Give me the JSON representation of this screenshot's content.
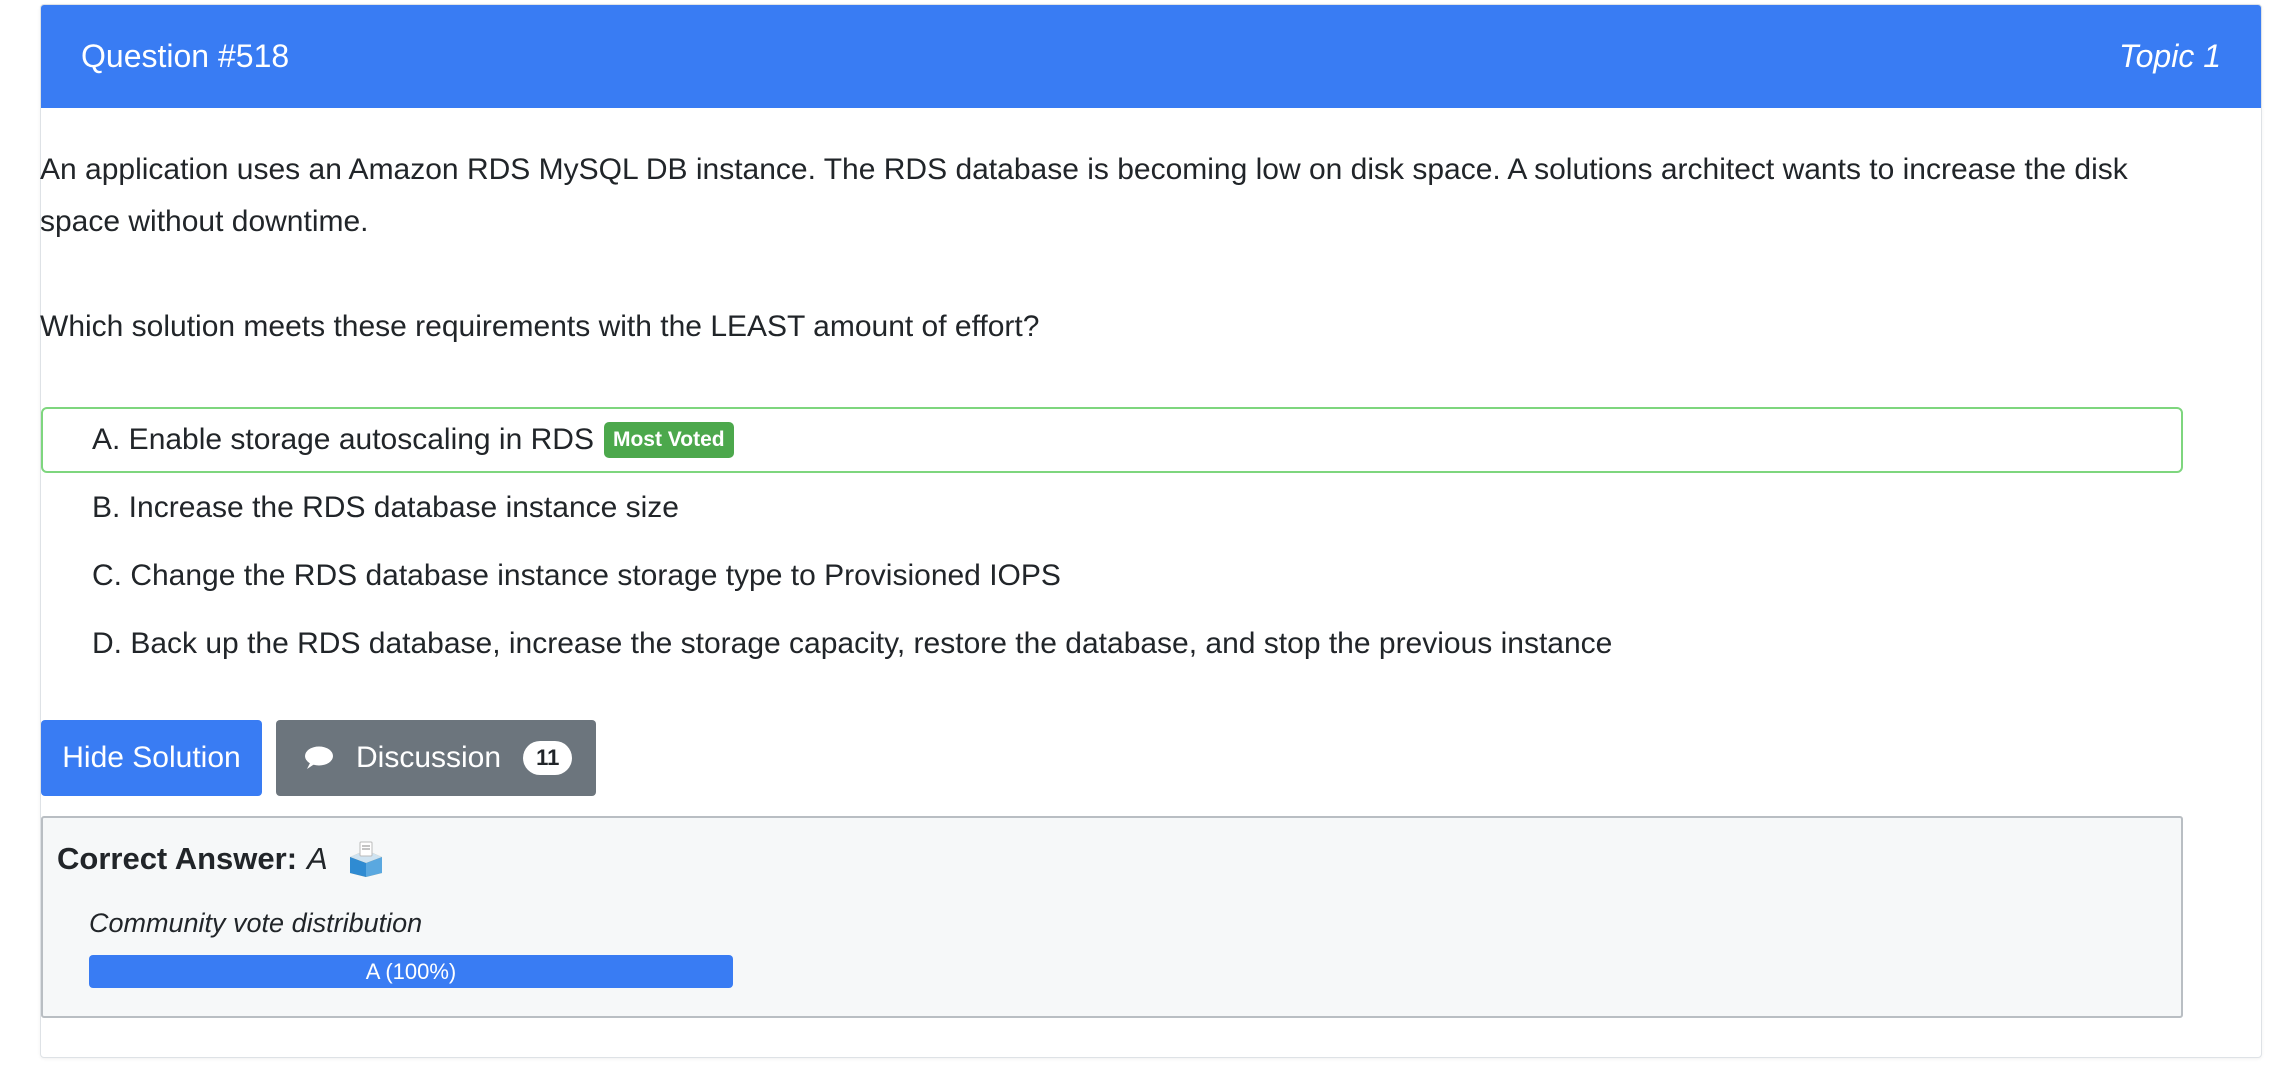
{
  "header": {
    "question_number": "Question #518",
    "topic": "Topic 1"
  },
  "question": {
    "text": "An application uses an Amazon RDS MySQL DB instance. The RDS database is becoming low on disk space. A solutions architect wants to increase the disk space without downtime.",
    "prompt": "Which solution meets these requirements with the LEAST amount of effort?"
  },
  "choices": [
    {
      "label": "A. Enable storage autoscaling in RDS",
      "badge": "Most Voted"
    },
    {
      "label": "B. Increase the RDS database instance size"
    },
    {
      "label": "C. Change the RDS database instance storage type to Provisioned IOPS"
    },
    {
      "label": "D. Back up the RDS database, increase the storage capacity, restore the database, and stop the previous instance"
    }
  ],
  "buttons": {
    "hide_solution": "Hide Solution",
    "discussion": "Discussion",
    "discussion_count": "11"
  },
  "answer": {
    "label": "Correct Answer:",
    "value": "A",
    "icon": "ballot-box-icon"
  },
  "votes": {
    "label": "Community vote distribution",
    "bar_text": "A (100%)",
    "fraction": 1.0
  },
  "colors": {
    "primary": "#397cf3",
    "secondary": "#6c757d",
    "most_voted": "#4ca84c",
    "correct_border": "#7ed67e"
  }
}
